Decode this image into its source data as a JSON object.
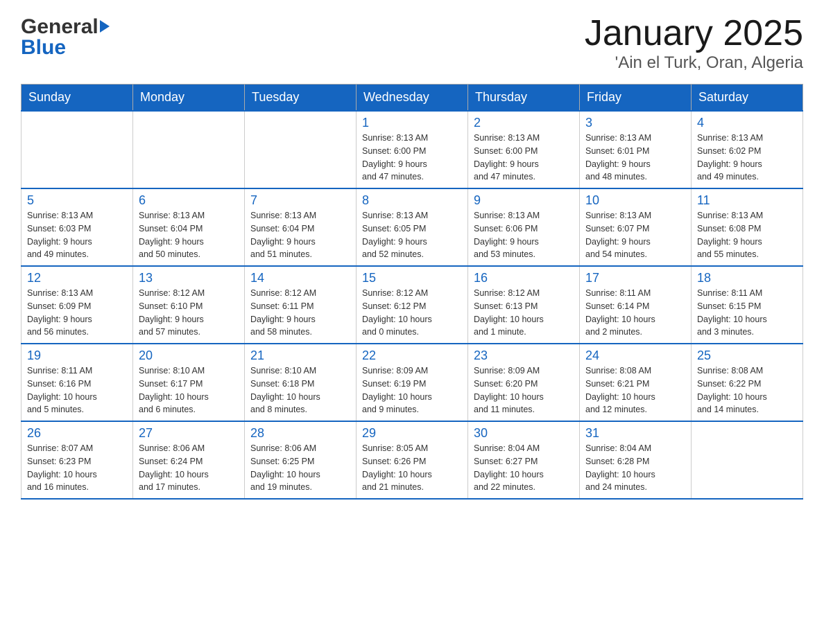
{
  "header": {
    "title": "January 2025",
    "subtitle": "'Ain el Turk, Oran, Algeria",
    "logo_general": "General",
    "logo_blue": "Blue"
  },
  "weekdays": [
    "Sunday",
    "Monday",
    "Tuesday",
    "Wednesday",
    "Thursday",
    "Friday",
    "Saturday"
  ],
  "weeks": [
    [
      {
        "day": "",
        "info": ""
      },
      {
        "day": "",
        "info": ""
      },
      {
        "day": "",
        "info": ""
      },
      {
        "day": "1",
        "info": "Sunrise: 8:13 AM\nSunset: 6:00 PM\nDaylight: 9 hours\nand 47 minutes."
      },
      {
        "day": "2",
        "info": "Sunrise: 8:13 AM\nSunset: 6:00 PM\nDaylight: 9 hours\nand 47 minutes."
      },
      {
        "day": "3",
        "info": "Sunrise: 8:13 AM\nSunset: 6:01 PM\nDaylight: 9 hours\nand 48 minutes."
      },
      {
        "day": "4",
        "info": "Sunrise: 8:13 AM\nSunset: 6:02 PM\nDaylight: 9 hours\nand 49 minutes."
      }
    ],
    [
      {
        "day": "5",
        "info": "Sunrise: 8:13 AM\nSunset: 6:03 PM\nDaylight: 9 hours\nand 49 minutes."
      },
      {
        "day": "6",
        "info": "Sunrise: 8:13 AM\nSunset: 6:04 PM\nDaylight: 9 hours\nand 50 minutes."
      },
      {
        "day": "7",
        "info": "Sunrise: 8:13 AM\nSunset: 6:04 PM\nDaylight: 9 hours\nand 51 minutes."
      },
      {
        "day": "8",
        "info": "Sunrise: 8:13 AM\nSunset: 6:05 PM\nDaylight: 9 hours\nand 52 minutes."
      },
      {
        "day": "9",
        "info": "Sunrise: 8:13 AM\nSunset: 6:06 PM\nDaylight: 9 hours\nand 53 minutes."
      },
      {
        "day": "10",
        "info": "Sunrise: 8:13 AM\nSunset: 6:07 PM\nDaylight: 9 hours\nand 54 minutes."
      },
      {
        "day": "11",
        "info": "Sunrise: 8:13 AM\nSunset: 6:08 PM\nDaylight: 9 hours\nand 55 minutes."
      }
    ],
    [
      {
        "day": "12",
        "info": "Sunrise: 8:13 AM\nSunset: 6:09 PM\nDaylight: 9 hours\nand 56 minutes."
      },
      {
        "day": "13",
        "info": "Sunrise: 8:12 AM\nSunset: 6:10 PM\nDaylight: 9 hours\nand 57 minutes."
      },
      {
        "day": "14",
        "info": "Sunrise: 8:12 AM\nSunset: 6:11 PM\nDaylight: 9 hours\nand 58 minutes."
      },
      {
        "day": "15",
        "info": "Sunrise: 8:12 AM\nSunset: 6:12 PM\nDaylight: 10 hours\nand 0 minutes."
      },
      {
        "day": "16",
        "info": "Sunrise: 8:12 AM\nSunset: 6:13 PM\nDaylight: 10 hours\nand 1 minute."
      },
      {
        "day": "17",
        "info": "Sunrise: 8:11 AM\nSunset: 6:14 PM\nDaylight: 10 hours\nand 2 minutes."
      },
      {
        "day": "18",
        "info": "Sunrise: 8:11 AM\nSunset: 6:15 PM\nDaylight: 10 hours\nand 3 minutes."
      }
    ],
    [
      {
        "day": "19",
        "info": "Sunrise: 8:11 AM\nSunset: 6:16 PM\nDaylight: 10 hours\nand 5 minutes."
      },
      {
        "day": "20",
        "info": "Sunrise: 8:10 AM\nSunset: 6:17 PM\nDaylight: 10 hours\nand 6 minutes."
      },
      {
        "day": "21",
        "info": "Sunrise: 8:10 AM\nSunset: 6:18 PM\nDaylight: 10 hours\nand 8 minutes."
      },
      {
        "day": "22",
        "info": "Sunrise: 8:09 AM\nSunset: 6:19 PM\nDaylight: 10 hours\nand 9 minutes."
      },
      {
        "day": "23",
        "info": "Sunrise: 8:09 AM\nSunset: 6:20 PM\nDaylight: 10 hours\nand 11 minutes."
      },
      {
        "day": "24",
        "info": "Sunrise: 8:08 AM\nSunset: 6:21 PM\nDaylight: 10 hours\nand 12 minutes."
      },
      {
        "day": "25",
        "info": "Sunrise: 8:08 AM\nSunset: 6:22 PM\nDaylight: 10 hours\nand 14 minutes."
      }
    ],
    [
      {
        "day": "26",
        "info": "Sunrise: 8:07 AM\nSunset: 6:23 PM\nDaylight: 10 hours\nand 16 minutes."
      },
      {
        "day": "27",
        "info": "Sunrise: 8:06 AM\nSunset: 6:24 PM\nDaylight: 10 hours\nand 17 minutes."
      },
      {
        "day": "28",
        "info": "Sunrise: 8:06 AM\nSunset: 6:25 PM\nDaylight: 10 hours\nand 19 minutes."
      },
      {
        "day": "29",
        "info": "Sunrise: 8:05 AM\nSunset: 6:26 PM\nDaylight: 10 hours\nand 21 minutes."
      },
      {
        "day": "30",
        "info": "Sunrise: 8:04 AM\nSunset: 6:27 PM\nDaylight: 10 hours\nand 22 minutes."
      },
      {
        "day": "31",
        "info": "Sunrise: 8:04 AM\nSunset: 6:28 PM\nDaylight: 10 hours\nand 24 minutes."
      },
      {
        "day": "",
        "info": ""
      }
    ]
  ]
}
